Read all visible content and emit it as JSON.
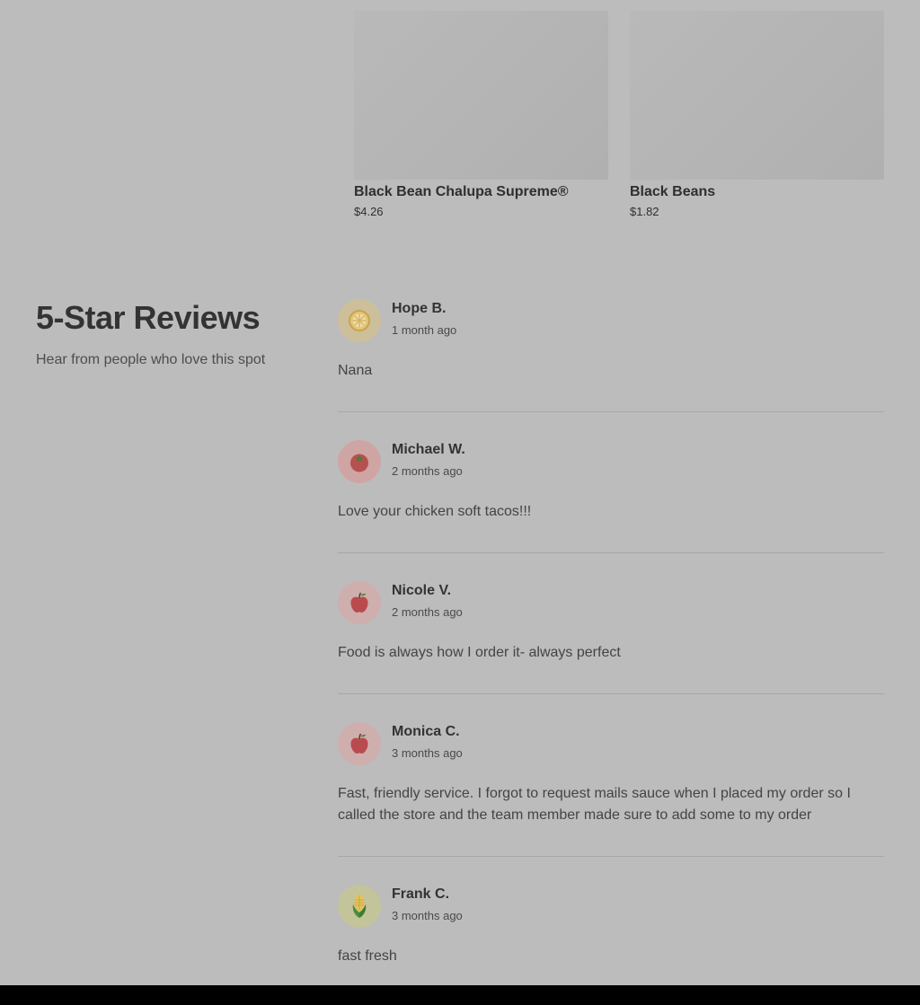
{
  "products": [
    {
      "name": "Black Bean Chalupa Supreme®",
      "price": "$4.26"
    },
    {
      "name": "Black Beans",
      "price": "$1.82"
    }
  ],
  "reviews_section": {
    "title": "5-Star Reviews",
    "subtitle": "Hear from people who love this spot"
  },
  "reviews": [
    {
      "author": "Hope B.",
      "time": "1 month ago",
      "text": "Nana",
      "avatar_icon": "lemon-slice-icon",
      "avatar_bg": "#cdbf9a"
    },
    {
      "author": "Michael W.",
      "time": "2 months ago",
      "text": "Love your chicken soft tacos!!!",
      "avatar_icon": "tomato-icon",
      "avatar_bg": "#cfa5a3"
    },
    {
      "author": "Nicole V.",
      "time": "2 months ago",
      "text": "Food is always how I order it- always perfect",
      "avatar_icon": "apple-icon",
      "avatar_bg": "#cfaeae"
    },
    {
      "author": "Monica C.",
      "time": "3 months ago",
      "text": "Fast, friendly service. I forgot to request mails sauce when I placed my order so I called the store and the team member made sure to add some to my order",
      "avatar_icon": "apple-icon",
      "avatar_bg": "#cfaeae"
    },
    {
      "author": "Frank C.",
      "time": "3 months ago",
      "text": "fast fresh",
      "avatar_icon": "corn-icon",
      "avatar_bg": "#c3c49a"
    }
  ]
}
